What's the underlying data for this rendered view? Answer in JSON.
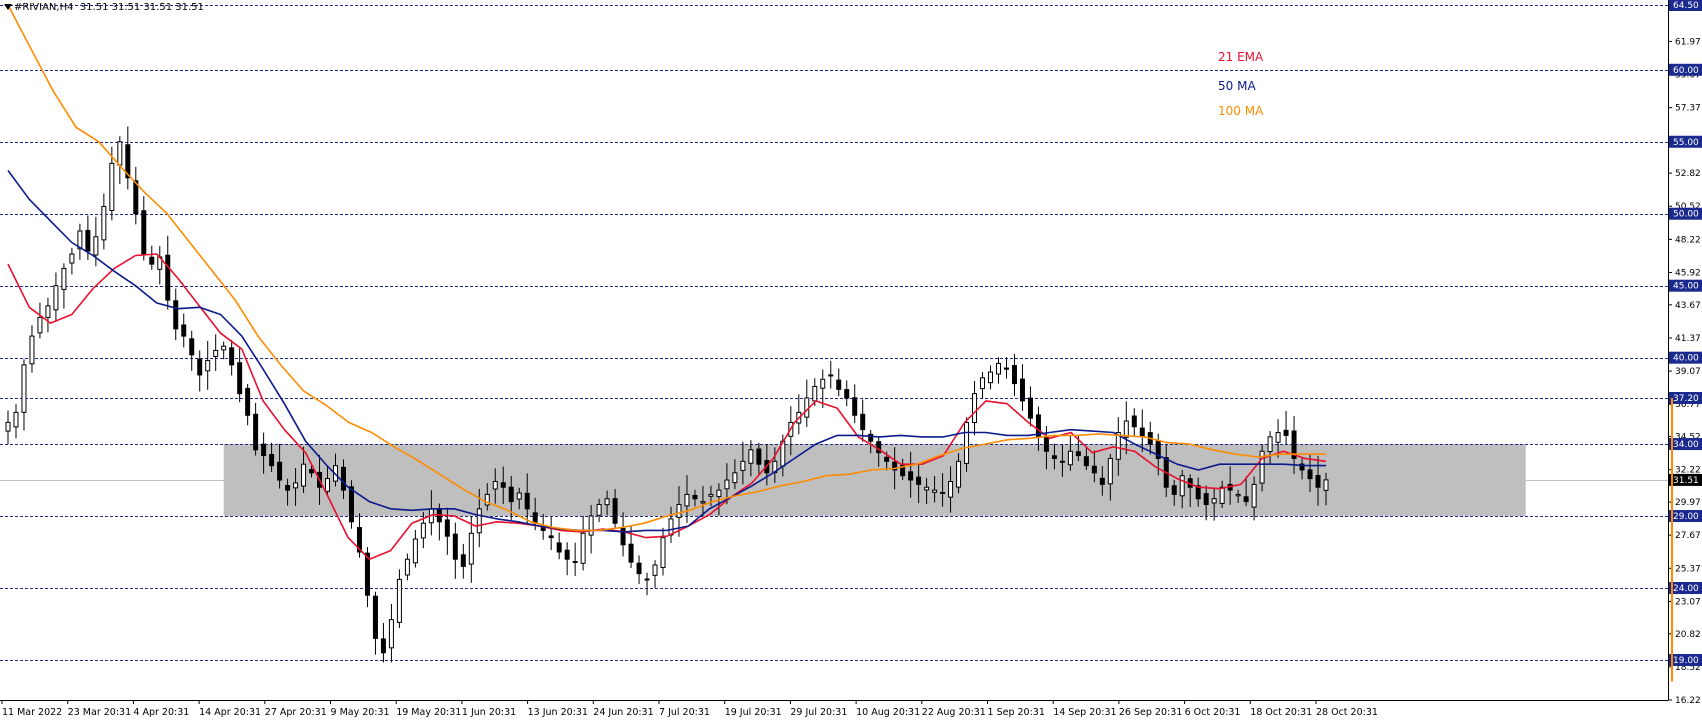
{
  "header": {
    "symbol_label": "#RIVIAN,H4",
    "ohlc": "31.51 31.51 31.51 31.51"
  },
  "legend": [
    {
      "label": "21 EMA",
      "color": "#e8102e"
    },
    {
      "label": "50 MA",
      "color": "#0b1a8c"
    },
    {
      "label": "100 MA",
      "color": "#ff8c00"
    }
  ],
  "colors": {
    "grid_dashed": "#1b2a8f",
    "zone_fill": "#bfbfbf",
    "axis": "#000000",
    "candle": "#000000",
    "price_tag_bg": "#1b2a8f",
    "current_price_bg": "#000000",
    "orange_bar": "#ff8c00"
  },
  "icons": [
    "dropdown-triangle-icon"
  ],
  "chart_data": {
    "type": "candlestick",
    "ylim": [
      16.22,
      64.5
    ],
    "y_ticks": [
      "64.50",
      "61.97",
      "59.67",
      "57.37",
      "54.92",
      "52.82",
      "50.52",
      "48.22",
      "45.92",
      "43.67",
      "41.37",
      "39.07",
      "36.77",
      "34.52",
      "32.22",
      "29.97",
      "27.67",
      "25.37",
      "23.07",
      "20.82",
      "18.52",
      "16.22"
    ],
    "x_labels": [
      "11 Mar 2022",
      "23 Mar 20:31",
      "4 Apr 20:31",
      "14 Apr 20:31",
      "27 Apr 20:31",
      "9 May 20:31",
      "19 May 20:31",
      "1 Jun 20:31",
      "13 Jun 20:31",
      "24 Jun 20:31",
      "7 Jul 20:31",
      "19 Jul 20:31",
      "29 Jul 20:31",
      "10 Aug 20:31",
      "22 Aug 20:31",
      "1 Sep 20:31",
      "14 Sep 20:31",
      "26 Sep 20:31",
      "6 Oct 20:31",
      "18 Oct 20:31",
      "28 Oct 20:31"
    ],
    "levels": [
      {
        "value": 64.5,
        "label": "64.50"
      },
      {
        "value": 60.0,
        "label": "60.00"
      },
      {
        "value": 55.0,
        "label": "55.00"
      },
      {
        "value": 50.0,
        "label": "50.00"
      },
      {
        "value": 45.0,
        "label": "45.00"
      },
      {
        "value": 40.0,
        "label": "40.00"
      },
      {
        "value": 37.2,
        "label": "37.20"
      },
      {
        "value": 34.0,
        "label": "34.00"
      },
      {
        "value": 29.0,
        "label": "29.00"
      },
      {
        "value": 24.0,
        "label": "24.00"
      },
      {
        "value": 19.0,
        "label": "19.00"
      }
    ],
    "current_price": {
      "value": 31.51,
      "label": "31.51"
    },
    "zone": {
      "from_bar": 27,
      "to_bar": 190,
      "top": 34.0,
      "bottom": 29.0
    },
    "closes": [
      35.5,
      36.2,
      39.5,
      41.5,
      42.8,
      43.6,
      45.0,
      46.2,
      47.2,
      48.8,
      47.4,
      48.4,
      50.5,
      53.5,
      55.0,
      52.5,
      50.0,
      47.2,
      46.5,
      47.0,
      44.0,
      42.0,
      41.5,
      40.2,
      38.8,
      39.8,
      40.5,
      40.8,
      39.5,
      37.5,
      36.0,
      33.6,
      33.2,
      32.5,
      31.5,
      30.8,
      31.3,
      32.6,
      32.0,
      31.0,
      31.6,
      32.5,
      30.8,
      28.6,
      26.5,
      23.5,
      20.5,
      19.5,
      21.8,
      24.6,
      26.0,
      27.4,
      28.5,
      29.5,
      28.6,
      27.6,
      26.0,
      25.5,
      27.8,
      29.5,
      30.5,
      31.4,
      31.0,
      30.0,
      30.6,
      29.5,
      28.5,
      28.0,
      27.5,
      26.5,
      26.0,
      25.8,
      27.8,
      29.0,
      29.8,
      30.2,
      28.5,
      27.0,
      25.8,
      25.0,
      24.6,
      25.6,
      27.5,
      28.8,
      29.8,
      30.5,
      30.2,
      30.0,
      30.5,
      30.8,
      31.5,
      32.0,
      32.8,
      33.6,
      32.6,
      32.0,
      32.8,
      34.2,
      35.5,
      36.2,
      37.2,
      38.0,
      38.5,
      38.8,
      37.8,
      37.2,
      36.0,
      35.0,
      34.2,
      33.4,
      32.8,
      32.2,
      31.8,
      31.5,
      31.2,
      31.0,
      30.8,
      30.6,
      31.4,
      32.8,
      35.5,
      37.5,
      38.6,
      39.0,
      39.6,
      39.2,
      38.2,
      37.0,
      35.8,
      34.5,
      33.5,
      33.0,
      32.8,
      33.5,
      33.2,
      32.5,
      32.0,
      31.2,
      33.0,
      34.8,
      35.6,
      35.2,
      34.5,
      34.0,
      33.0,
      31.0,
      30.5,
      31.8,
      31.0,
      30.2,
      29.8,
      30.2,
      31.0,
      30.8,
      30.5,
      30.0,
      31.2,
      33.5,
      34.5,
      34.8,
      34.6,
      33.0,
      32.2,
      31.6,
      31.0,
      31.51
    ],
    "series": [
      {
        "name": "21 EMA",
        "values": [
          46.5,
          43.5,
          42.4,
          43.0,
          44.8,
          46.2,
          47.1,
          47.2,
          45.5,
          43.6,
          41.7,
          40.6,
          37.0,
          35.0,
          33.4,
          30.5,
          27.5,
          26.0,
          26.6,
          28.5,
          29.1,
          29.0,
          28.3,
          28.6,
          28.5,
          28.3,
          28.0,
          27.9,
          28.1,
          27.9,
          27.5,
          27.6,
          28.3,
          29.1,
          30.3,
          31.3,
          33.0,
          35.5,
          37.0,
          36.5,
          34.5,
          33.6,
          32.6,
          32.6,
          33.2,
          35.5,
          37.0,
          36.8,
          35.5,
          34.4,
          34.8,
          33.4,
          33.8,
          33.5,
          32.4,
          31.6,
          31.0,
          30.9,
          31.2,
          33.0,
          33.5,
          33.0,
          32.8
        ]
      },
      {
        "name": "50 MA",
        "values": [
          53.0,
          51.0,
          49.5,
          48.0,
          47.1,
          46.0,
          45.0,
          43.8,
          43.4,
          43.5,
          43.0,
          41.5,
          39.2,
          36.8,
          34.2,
          32.5,
          31.0,
          30.0,
          29.5,
          29.4,
          29.5,
          29.5,
          29.1,
          28.8,
          28.6,
          28.3,
          28.1,
          28.0,
          28.0,
          27.9,
          28.0,
          28.0,
          28.3,
          29.5,
          30.3,
          31.1,
          32.0,
          33.0,
          34.0,
          34.6,
          34.6,
          34.5,
          34.6,
          34.5,
          34.5,
          34.8,
          34.8,
          34.6,
          34.6,
          34.8,
          35.0,
          34.9,
          34.8,
          34.0,
          33.3,
          32.6,
          32.2,
          32.6,
          32.6,
          32.6,
          32.6,
          32.5,
          32.5
        ]
      },
      {
        "name": "100 MA",
        "values": [
          64.5,
          61.5,
          58.5,
          56.0,
          55.0,
          53.2,
          51.5,
          50.0,
          48.0,
          46.0,
          44.0,
          41.5,
          39.5,
          37.7,
          36.7,
          35.5,
          34.8,
          33.8,
          32.9,
          31.9,
          30.9,
          30.0,
          29.4,
          28.6,
          28.2,
          28.0,
          28.0,
          28.2,
          28.5,
          29.0,
          29.4,
          30.0,
          30.4,
          30.7,
          31.1,
          31.4,
          31.8,
          31.9,
          32.2,
          32.3,
          32.6,
          33.2,
          33.7,
          34.0,
          34.3,
          34.4,
          34.6,
          34.6,
          34.7,
          34.6,
          34.5,
          34.1,
          34.0,
          33.6,
          33.3,
          33.1,
          33.3,
          33.3,
          33.3
        ]
      }
    ]
  }
}
